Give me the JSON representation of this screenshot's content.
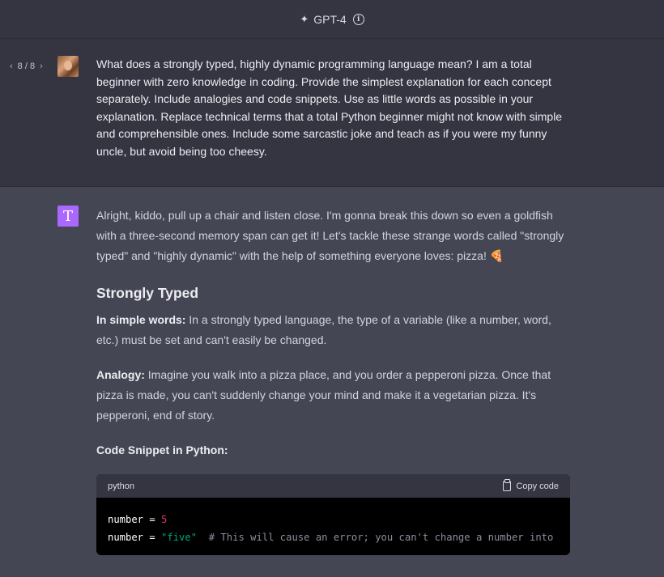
{
  "header": {
    "model_label": "GPT-4"
  },
  "user_message": {
    "pager": {
      "text": "8 / 8"
    },
    "text": "What does a strongly typed, highly dynamic programming language mean? I am a total beginner with zero knowledge in coding. Provide the simplest explanation for each concept separately. Include analogies and code snippets. Use as little words as possible in your explanation. Replace technical terms that a total Python beginner might not know with simple and comprehensible ones. Include some sarcastic joke and teach as if you were my funny uncle, but avoid being too cheesy."
  },
  "assistant_message": {
    "avatar_letter": "T",
    "intro": "Alright, kiddo, pull up a chair and listen close. I'm gonna break this down so even a goldfish with a three-second memory span can get it! Let's tackle these strange words called \"strongly typed\" and \"highly dynamic\" with the help of something everyone loves: pizza! 🍕",
    "heading": "Strongly Typed",
    "simple_label": "In simple words:",
    "simple_text": " In a strongly typed language, the type of a variable (like a number, word, etc.) must be set and can't easily be changed.",
    "analogy_label": "Analogy:",
    "analogy_text": " Imagine you walk into a pizza place, and you order a pepperoni pizza. Once that pizza is made, you can't suddenly change your mind and make it a vegetarian pizza. It's pepperoni, end of story.",
    "code_label": "Code Snippet in Python:",
    "code_block": {
      "language": "python",
      "copy_label": "Copy code",
      "line1": {
        "var": "number",
        "op": " = ",
        "value": "5"
      },
      "line2": {
        "var": "number",
        "op": " = ",
        "value": "\"five\"",
        "comment": "  # This will cause an error; you can't change a number into"
      }
    }
  }
}
